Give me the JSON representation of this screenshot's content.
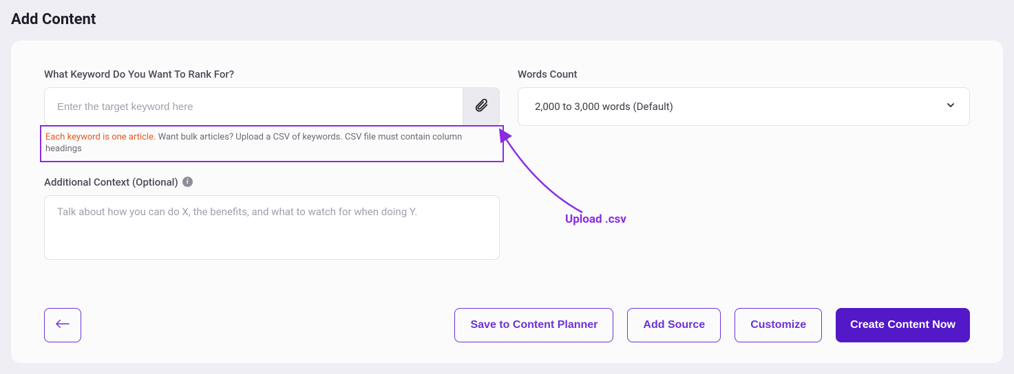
{
  "page": {
    "title": "Add Content"
  },
  "keyword": {
    "label": "What Keyword Do You Want To Rank For?",
    "placeholder": "Enter the target keyword here",
    "helper_orange": "Each keyword is one article.",
    "helper_grey": " Want bulk articles? Upload a CSV of keywords. CSV file must contain column headings"
  },
  "words_count": {
    "label": "Words Count",
    "selected": "2,000 to 3,000 words (Default)"
  },
  "context": {
    "label": "Additional Context (Optional)",
    "placeholder": "Talk about how you can do X, the benefits, and what to watch for when doing Y."
  },
  "buttons": {
    "save_planner": "Save to Content Planner",
    "add_source": "Add Source",
    "customize": "Customize",
    "create_now": "Create Content Now"
  },
  "annotation": {
    "label": "Upload .csv"
  },
  "colors": {
    "accent": "#6a33d4",
    "primary": "#5318c8",
    "highlight": "#8a2be2",
    "warn": "#e55a1b"
  }
}
